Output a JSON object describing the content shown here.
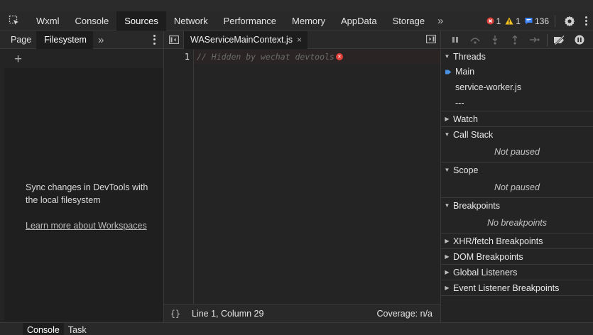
{
  "main_tabs": [
    "Wxml",
    "Console",
    "Sources",
    "Network",
    "Performance",
    "Memory",
    "AppData",
    "Storage"
  ],
  "active_main_tab": "Sources",
  "status": {
    "errors": "1",
    "warnings": "1",
    "messages": "136"
  },
  "navigator": {
    "tabs": [
      "Page",
      "Filesystem"
    ],
    "active_tab": "Filesystem",
    "sync_message": "Sync changes in DevTools with the local filesystem",
    "learn_more": "Learn more about Workspaces"
  },
  "editor": {
    "file_tab": "WAServiceMainContext.js",
    "line_number": "1",
    "code_line": "// Hidden by wechat devtools",
    "cursor_position": "Line 1, Column 29",
    "coverage": "Coverage: n/a"
  },
  "debugger": {
    "threads_title": "Threads",
    "threads": [
      "Main",
      "service-worker.js",
      "---"
    ],
    "watch": "Watch",
    "call_stack": "Call Stack",
    "call_stack_msg": "Not paused",
    "scope": "Scope",
    "scope_msg": "Not paused",
    "breakpoints": "Breakpoints",
    "breakpoints_msg": "No breakpoints",
    "xhr": "XHR/fetch Breakpoints",
    "dom": "DOM Breakpoints",
    "global": "Global Listeners",
    "event": "Event Listener Breakpoints"
  },
  "bottom_tabs": [
    "Console",
    "Task"
  ],
  "colors": {
    "error": "#e0403a",
    "warning": "#f2c11c",
    "info": "#3b82f6",
    "background": "#242424"
  }
}
